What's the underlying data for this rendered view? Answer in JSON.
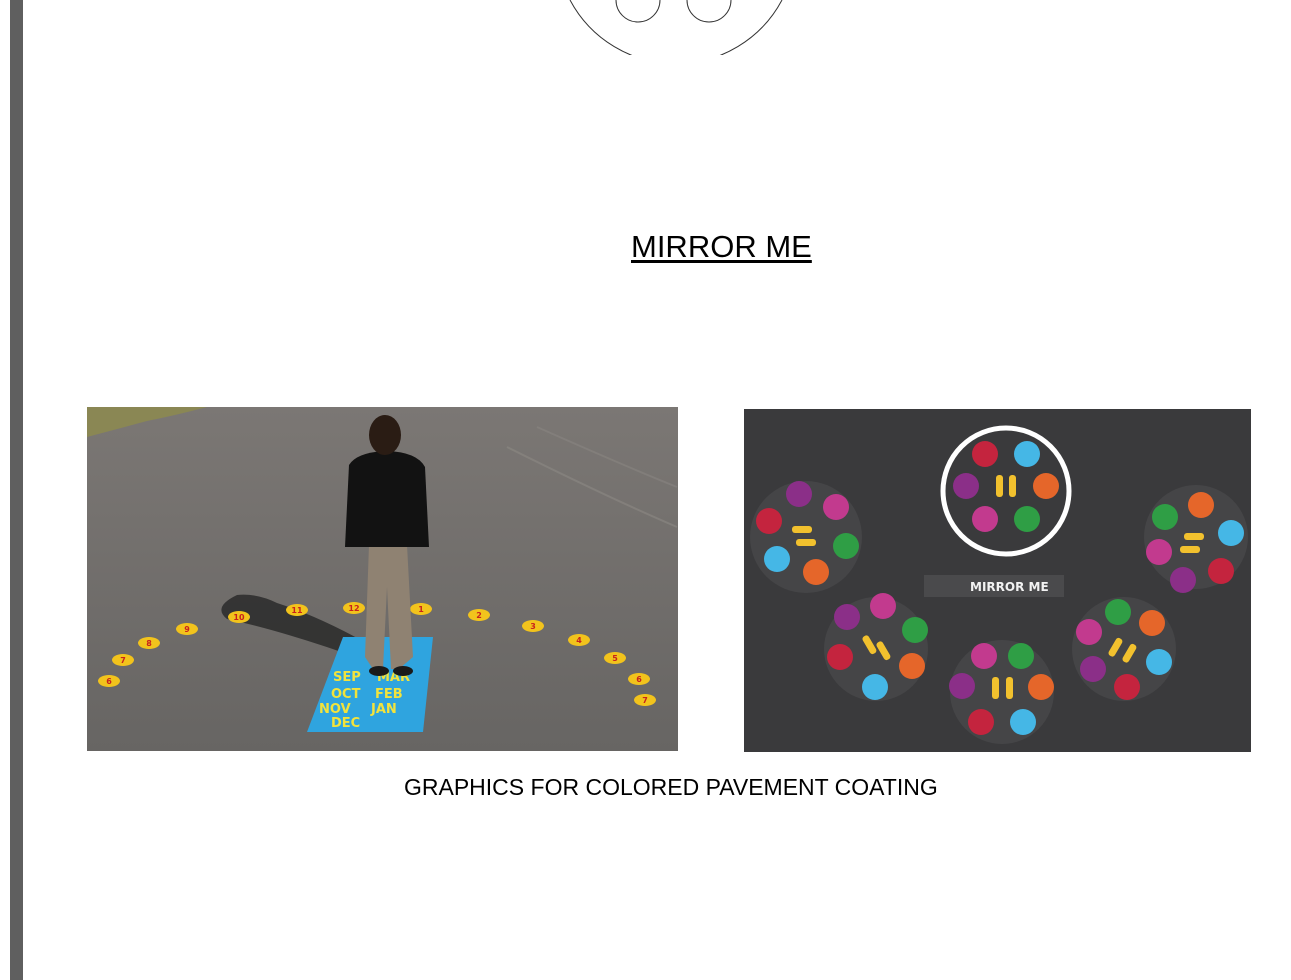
{
  "page": {
    "title": "MIRROR ME",
    "caption": "GRAPHICS FOR COLORED PAVEMENT COATING"
  },
  "photo_left": {
    "months": [
      "SEP",
      "MAR",
      "OCT",
      "FEB",
      "NOV",
      "JAN",
      "DEC"
    ],
    "numbers_left": [
      "6",
      "7",
      "8",
      "9",
      "10",
      "11",
      "12"
    ],
    "numbers_right": [
      "1",
      "2",
      "3",
      "4",
      "5",
      "6",
      "7"
    ],
    "colors": {
      "asphalt": "#6f6d6b",
      "mat": "#2fa4df",
      "dot": "#f2c31c",
      "digit": "#c8211c"
    }
  },
  "photo_right": {
    "label": "MIRROR ME",
    "colors": {
      "asphalt": "#3a3a3c",
      "footprint": "#f2c12e"
    }
  }
}
